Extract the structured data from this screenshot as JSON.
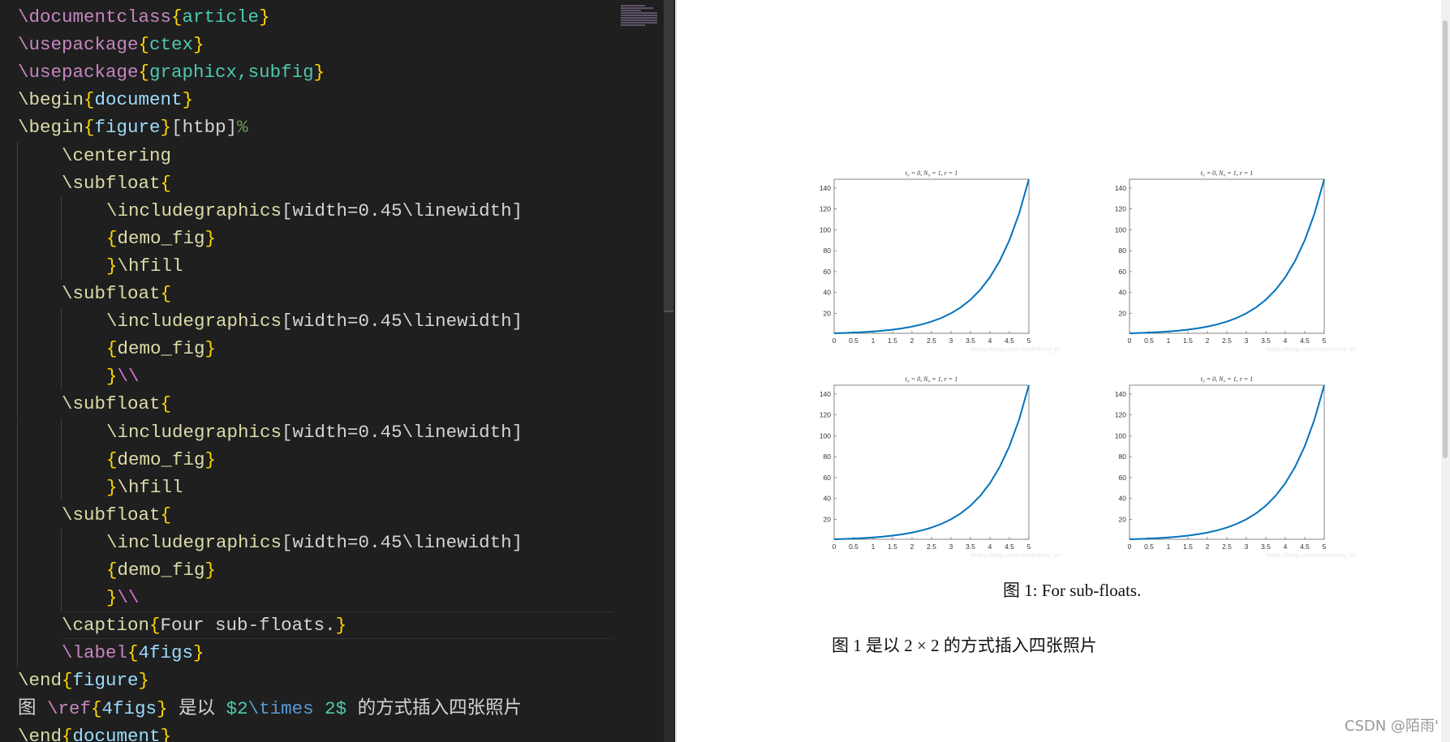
{
  "editor": {
    "lines": [
      {
        "indent": 0,
        "tokens": [
          {
            "c": "kw",
            "t": "\\documentclass"
          },
          {
            "c": "br",
            "t": "{"
          },
          {
            "c": "arg",
            "t": "article"
          },
          {
            "c": "br",
            "t": "}"
          }
        ]
      },
      {
        "indent": 0,
        "tokens": [
          {
            "c": "kw",
            "t": "\\usepackage"
          },
          {
            "c": "br",
            "t": "{"
          },
          {
            "c": "arg",
            "t": "ctex"
          },
          {
            "c": "br",
            "t": "}"
          }
        ]
      },
      {
        "indent": 0,
        "tokens": [
          {
            "c": "kw",
            "t": "\\usepackage"
          },
          {
            "c": "br",
            "t": "{"
          },
          {
            "c": "arg",
            "t": "graphicx,subfig"
          },
          {
            "c": "br",
            "t": "}"
          }
        ]
      },
      {
        "indent": 0,
        "tokens": [
          {
            "c": "cmd",
            "t": "\\begin"
          },
          {
            "c": "br",
            "t": "{"
          },
          {
            "c": "env",
            "t": "document"
          },
          {
            "c": "br",
            "t": "}"
          }
        ]
      },
      {
        "indent": 0,
        "tokens": [
          {
            "c": "cmd",
            "t": "\\begin"
          },
          {
            "c": "br",
            "t": "{"
          },
          {
            "c": "env",
            "t": "figure"
          },
          {
            "c": "br",
            "t": "}"
          },
          {
            "c": "txt",
            "t": "[htbp]"
          },
          {
            "c": "com",
            "t": "%"
          }
        ]
      },
      {
        "indent": 1,
        "tokens": [
          {
            "c": "cmd",
            "t": "\\centering"
          }
        ]
      },
      {
        "indent": 1,
        "tokens": [
          {
            "c": "cmd",
            "t": "\\subfloat"
          },
          {
            "c": "br",
            "t": "{"
          }
        ]
      },
      {
        "indent": 2,
        "tokens": [
          {
            "c": "cmd",
            "t": "\\includegraphics"
          },
          {
            "c": "txt",
            "t": "[width=0.45\\linewidth]"
          }
        ]
      },
      {
        "indent": 2,
        "tokens": [
          {
            "c": "br",
            "t": "{"
          },
          {
            "c": "cmd",
            "t": "demo_fig"
          },
          {
            "c": "br",
            "t": "}"
          }
        ]
      },
      {
        "indent": 2,
        "tokens": [
          {
            "c": "br",
            "t": "}"
          },
          {
            "c": "cmd",
            "t": "\\hfill"
          }
        ]
      },
      {
        "indent": 1,
        "tokens": [
          {
            "c": "cmd",
            "t": "\\subfloat"
          },
          {
            "c": "br",
            "t": "{"
          }
        ]
      },
      {
        "indent": 2,
        "tokens": [
          {
            "c": "cmd",
            "t": "\\includegraphics"
          },
          {
            "c": "txt",
            "t": "[width=0.45\\linewidth]"
          }
        ]
      },
      {
        "indent": 2,
        "tokens": [
          {
            "c": "br",
            "t": "{"
          },
          {
            "c": "cmd",
            "t": "demo_fig"
          },
          {
            "c": "br",
            "t": "}"
          }
        ]
      },
      {
        "indent": 2,
        "tokens": [
          {
            "c": "br",
            "t": "}"
          },
          {
            "c": "brk",
            "t": "\\\\"
          }
        ]
      },
      {
        "indent": 1,
        "tokens": [
          {
            "c": "cmd",
            "t": "\\subfloat"
          },
          {
            "c": "br",
            "t": "{"
          }
        ]
      },
      {
        "indent": 2,
        "tokens": [
          {
            "c": "cmd",
            "t": "\\includegraphics"
          },
          {
            "c": "txt",
            "t": "[width=0.45\\linewidth]"
          }
        ]
      },
      {
        "indent": 2,
        "tokens": [
          {
            "c": "br",
            "t": "{"
          },
          {
            "c": "cmd",
            "t": "demo_fig"
          },
          {
            "c": "br",
            "t": "}"
          }
        ]
      },
      {
        "indent": 2,
        "tokens": [
          {
            "c": "br",
            "t": "}"
          },
          {
            "c": "cmd",
            "t": "\\hfill"
          }
        ]
      },
      {
        "indent": 1,
        "tokens": [
          {
            "c": "cmd",
            "t": "\\subfloat"
          },
          {
            "c": "br",
            "t": "{"
          }
        ]
      },
      {
        "indent": 2,
        "tokens": [
          {
            "c": "cmd",
            "t": "\\includegraphics"
          },
          {
            "c": "txt",
            "t": "[width=0.45\\linewidth]"
          }
        ]
      },
      {
        "indent": 2,
        "tokens": [
          {
            "c": "br",
            "t": "{"
          },
          {
            "c": "cmd",
            "t": "demo_fig"
          },
          {
            "c": "br",
            "t": "}"
          }
        ]
      },
      {
        "indent": 2,
        "tokens": [
          {
            "c": "br",
            "t": "}"
          },
          {
            "c": "brk",
            "t": "\\\\"
          }
        ]
      },
      {
        "indent": 1,
        "current": true,
        "tokens": [
          {
            "c": "cmd",
            "t": "\\caption"
          },
          {
            "c": "br",
            "t": "{"
          },
          {
            "c": "txt",
            "t": "Four sub-floats."
          },
          {
            "c": "br",
            "t": "}"
          }
        ]
      },
      {
        "indent": 1,
        "tokens": [
          {
            "c": "kw",
            "t": "\\label"
          },
          {
            "c": "br",
            "t": "{"
          },
          {
            "c": "env",
            "t": "4figs"
          },
          {
            "c": "br",
            "t": "}"
          }
        ]
      },
      {
        "indent": 0,
        "tokens": [
          {
            "c": "cmd",
            "t": "\\end"
          },
          {
            "c": "br",
            "t": "{"
          },
          {
            "c": "env",
            "t": "figure"
          },
          {
            "c": "br",
            "t": "}"
          }
        ]
      },
      {
        "indent": 0,
        "tokens": [
          {
            "c": "txt",
            "t": "图 "
          },
          {
            "c": "kw",
            "t": "\\ref"
          },
          {
            "c": "br",
            "t": "{"
          },
          {
            "c": "env",
            "t": "4figs"
          },
          {
            "c": "br",
            "t": "}"
          },
          {
            "c": "txt",
            "t": " 是以 "
          },
          {
            "c": "math",
            "t": "$2"
          },
          {
            "c": "mcmd",
            "t": "\\times"
          },
          {
            "c": "math",
            "t": " 2$"
          },
          {
            "c": "txt",
            "t": " 的方式插入四张照片"
          }
        ]
      },
      {
        "indent": 0,
        "tokens": [
          {
            "c": "cmd",
            "t": "\\end"
          },
          {
            "c": "br",
            "t": "{"
          },
          {
            "c": "env",
            "t": "document"
          },
          {
            "c": "br",
            "t": "}"
          }
        ]
      }
    ]
  },
  "preview": {
    "caption": "图 1: For sub-floats.",
    "paragraph": "图 1 是以 2 × 2 的方式插入四张照片",
    "figure_watermark": "https://blog.csdn.net/infinity_07",
    "page_watermark": "CSDN @陌雨'"
  },
  "chart_data": {
    "type": "line",
    "panels": 4,
    "title": "t₀ = 0, N₀ = 1, r = 1",
    "x": [
      0,
      0.25,
      0.5,
      0.75,
      1,
      1.25,
      1.5,
      1.75,
      2,
      2.25,
      2.5,
      2.75,
      3,
      3.25,
      3.5,
      3.75,
      4,
      4.25,
      4.5,
      4.75,
      5
    ],
    "y": [
      1,
      1.28,
      1.65,
      2.12,
      2.72,
      3.49,
      4.48,
      5.75,
      7.39,
      9.49,
      12.18,
      15.64,
      20.09,
      25.79,
      33.12,
      42.52,
      54.6,
      70.11,
      90.02,
      115.58,
      148.41
    ],
    "xlim": [
      0,
      5
    ],
    "ylim": [
      1,
      148.41
    ],
    "xticks": [
      "0",
      "0.5",
      "1",
      "1.5",
      "2",
      "2.5",
      "3",
      "3.5",
      "4",
      "4.5",
      "5"
    ],
    "yticks": [
      "20",
      "40",
      "60",
      "80",
      "100",
      "120",
      "140"
    ],
    "color": "#0072bd",
    "grid": false
  }
}
